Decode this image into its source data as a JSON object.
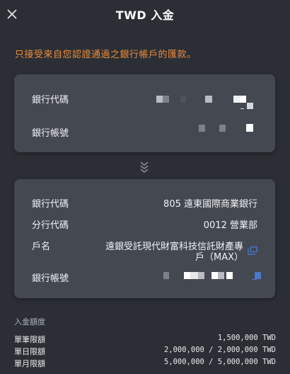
{
  "header": {
    "title": "TWD 入金"
  },
  "notice": "只接受來自您認證通過之銀行帳戶的匯款。",
  "source_account": {
    "bank_code_label": "銀行代碼",
    "account_number_label": "銀行帳號"
  },
  "destination_account": {
    "bank_code_label": "銀行代碼",
    "bank_code_value": "805 遠東國際商業銀行",
    "branch_code_label": "分行代碼",
    "branch_code_value": "0012 營業部",
    "account_name_label": "戶名",
    "account_name_line1": "遠銀受託現代財富科技信託財產專",
    "account_name_line2": "戶（MAX）",
    "account_number_label": "銀行帳號"
  },
  "limits": {
    "title": "入金額度",
    "rows": [
      {
        "label": "單筆限額",
        "value": "1,500,000 TWD"
      },
      {
        "label": "單日限額",
        "value": "2,000,000 / 2,000,000 TWD"
      },
      {
        "label": "單月限額",
        "value": "5,000,000 / 5,000,000 TWD"
      }
    ]
  },
  "colors": {
    "accent": "#f08c3c",
    "card": "#434851",
    "background": "#2b2f35",
    "copy_icon": "#4a78c9"
  },
  "icons": {
    "close": "close-icon",
    "chevron": "double-chevron-down-icon",
    "copy": "copy-icon"
  }
}
